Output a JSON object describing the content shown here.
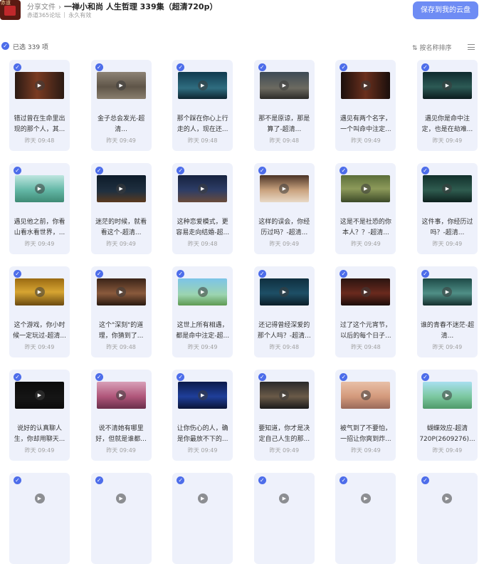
{
  "header": {
    "avatar_text": "赤道",
    "crumb_parent": "分享文件",
    "crumb_sep": "›",
    "title": "一禅小和尚 人生哲理 339集（超清720p）",
    "sharer": "赤道365论坛",
    "validity": "永久有效",
    "save_button": "保存到我的云盘"
  },
  "toolbar": {
    "selected_text": "已选 339 项",
    "sort_label": "按名称排序"
  },
  "files": [
    {
      "name": "错过曾在生命里出现的那个人，其...",
      "time": "昨天 09:48",
      "thumb": "linear-gradient(90deg,#2a1a14,#7a3b22 45%,#2a1a14)"
    },
    {
      "name": "金子总会发光-超清...",
      "time": "昨天 09:49",
      "thumb": "linear-gradient(180deg,#8d8376,#5f5548 55%,#8a7f6f)"
    },
    {
      "name": "那个踩在你心上行走的人，现在还...",
      "time": "昨天 09:48",
      "thumb": "linear-gradient(180deg,#103a4f,#2f6d80 60%,#0d2430)"
    },
    {
      "name": "那不是原谅，那是算了-超清...",
      "time": "昨天 09:48",
      "thumb": "linear-gradient(180deg,#3d4a55,#6c6a60 60%,#2b2a28)"
    },
    {
      "name": "遇见有两个名字，一个叫命中注定...",
      "time": "昨天 09:49",
      "thumb": "linear-gradient(90deg,#1a0f0c,#6a2f1d 50%,#1a0f0c)"
    },
    {
      "name": "遇见你是命中注定，也是在劫难...",
      "time": "昨天 09:49",
      "thumb": "linear-gradient(180deg,#0f2a2e,#2c5a55 55%,#0c1c1e)"
    },
    {
      "name": "遇见他之前，你看山看水看世界，...",
      "time": "昨天 09:49",
      "thumb": "linear-gradient(180deg,#bfe6e0,#63b7a6 55%,#3f8a75)"
    },
    {
      "name": "迷茫的时候，就看看这个-超清...",
      "time": "昨天 09:49",
      "thumb": "linear-gradient(180deg,#0d1b2a,#203040 60%,#5c3a1e)"
    },
    {
      "name": "这种恋爱模式，更容易走向结婚-超...",
      "time": "昨天 09:48",
      "thumb": "linear-gradient(180deg,#16223f,#2d3d66 55%,#6a4b3a)"
    },
    {
      "name": "这样的误会，你经历过吗？-超清...",
      "time": "昨天 09:49",
      "thumb": "linear-gradient(180deg,#4a3326,#c9a27e 55%,#e8d9c6)"
    },
    {
      "name": "这是不是社恐的你本人？？-超清...",
      "time": "昨天 09:49",
      "thumb": "linear-gradient(180deg,#5b6e3a,#8d9a5a 50%,#3c4a28)"
    },
    {
      "name": "这件事，你经历过吗？-超清...",
      "time": "昨天 09:49",
      "thumb": "linear-gradient(180deg,#12302c,#2f5c4f 55%,#0d201d)"
    },
    {
      "name": "这个游戏，你小时候一定玩过-超清...",
      "time": "昨天 09:49",
      "thumb": "linear-gradient(180deg,#9a6a12,#d7a532 50%,#6b4a10)"
    },
    {
      "name": "这个\"深刻\"的道理，你猜到了...",
      "time": "昨天 09:48",
      "thumb": "linear-gradient(180deg,#3a2418,#8a5a3c 55%,#2a1a10)"
    },
    {
      "name": "这世上所有相遇，都是命中注定-超...",
      "time": "昨天 09:49",
      "thumb": "linear-gradient(180deg,#7cc4e8,#9cd4b0 60%,#5e9a52)"
    },
    {
      "name": "还记得曾经深爱的那个人吗？-超清...",
      "time": "昨天 09:48",
      "thumb": "linear-gradient(180deg,#0f2f3f,#1e4f66 55%,#0b1e28)"
    },
    {
      "name": "过了这个元宵节，以后的每个日子...",
      "time": "昨天 09:48",
      "thumb": "linear-gradient(180deg,#2a1410,#6a2a1e 55%,#1c0d0a)"
    },
    {
      "name": "谁的青春不迷茫-超清...",
      "time": "昨天 09:49",
      "thumb": "linear-gradient(180deg,#1e4a48,#4f8f86 55%,#16302e)"
    },
    {
      "name": "说好的认真聊人生，你却用聊天...",
      "time": "昨天 09:49",
      "thumb": "linear-gradient(180deg,#0b0b0b,#151515 60%,#0b0b0b)"
    },
    {
      "name": "说不清她有哪里好，但就是谁都...",
      "time": "昨天 09:49",
      "thumb": "linear-gradient(180deg,#d8a0b8,#b0567a 55%,#6a2f4a)"
    },
    {
      "name": "让你伤心的人，确是你最放不下的...",
      "time": "昨天 09:49",
      "thumb": "linear-gradient(180deg,#0c1a4a,#1f3f9a 55%,#0a1436)"
    },
    {
      "name": "要知道，你才是决定自己人生的那...",
      "time": "昨天 09:49",
      "thumb": "linear-gradient(180deg,#2a2a2a,#6a5a48 55%,#1a1a1a)"
    },
    {
      "name": "被气到了不要怕，一招让你爽到炸...",
      "time": "昨天 09:49",
      "thumb": "linear-gradient(180deg,#e8c0a8,#d49a7c 55%,#9a6a5a)"
    },
    {
      "name": "蝴蝶效应-超清720P(2609276)...",
      "time": "昨天 09:49",
      "thumb": "linear-gradient(180deg,#a8dff0,#7cc8a0 55%,#4f9a6a)"
    },
    {
      "name": "",
      "time": "",
      "thumb": "linear-gradient(180deg,#eef1fb,#eef1fb)"
    },
    {
      "name": "",
      "time": "",
      "thumb": "linear-gradient(180deg,#eef1fb,#eef1fb)"
    },
    {
      "name": "",
      "time": "",
      "thumb": "linear-gradient(180deg,#eef1fb,#eef1fb)"
    },
    {
      "name": "",
      "time": "",
      "thumb": "linear-gradient(180deg,#eef1fb,#eef1fb)"
    },
    {
      "name": "",
      "time": "",
      "thumb": "linear-gradient(180deg,#eef1fb,#eef1fb)"
    },
    {
      "name": "",
      "time": "",
      "thumb": "linear-gradient(180deg,#eef1fb,#eef1fb)"
    }
  ]
}
